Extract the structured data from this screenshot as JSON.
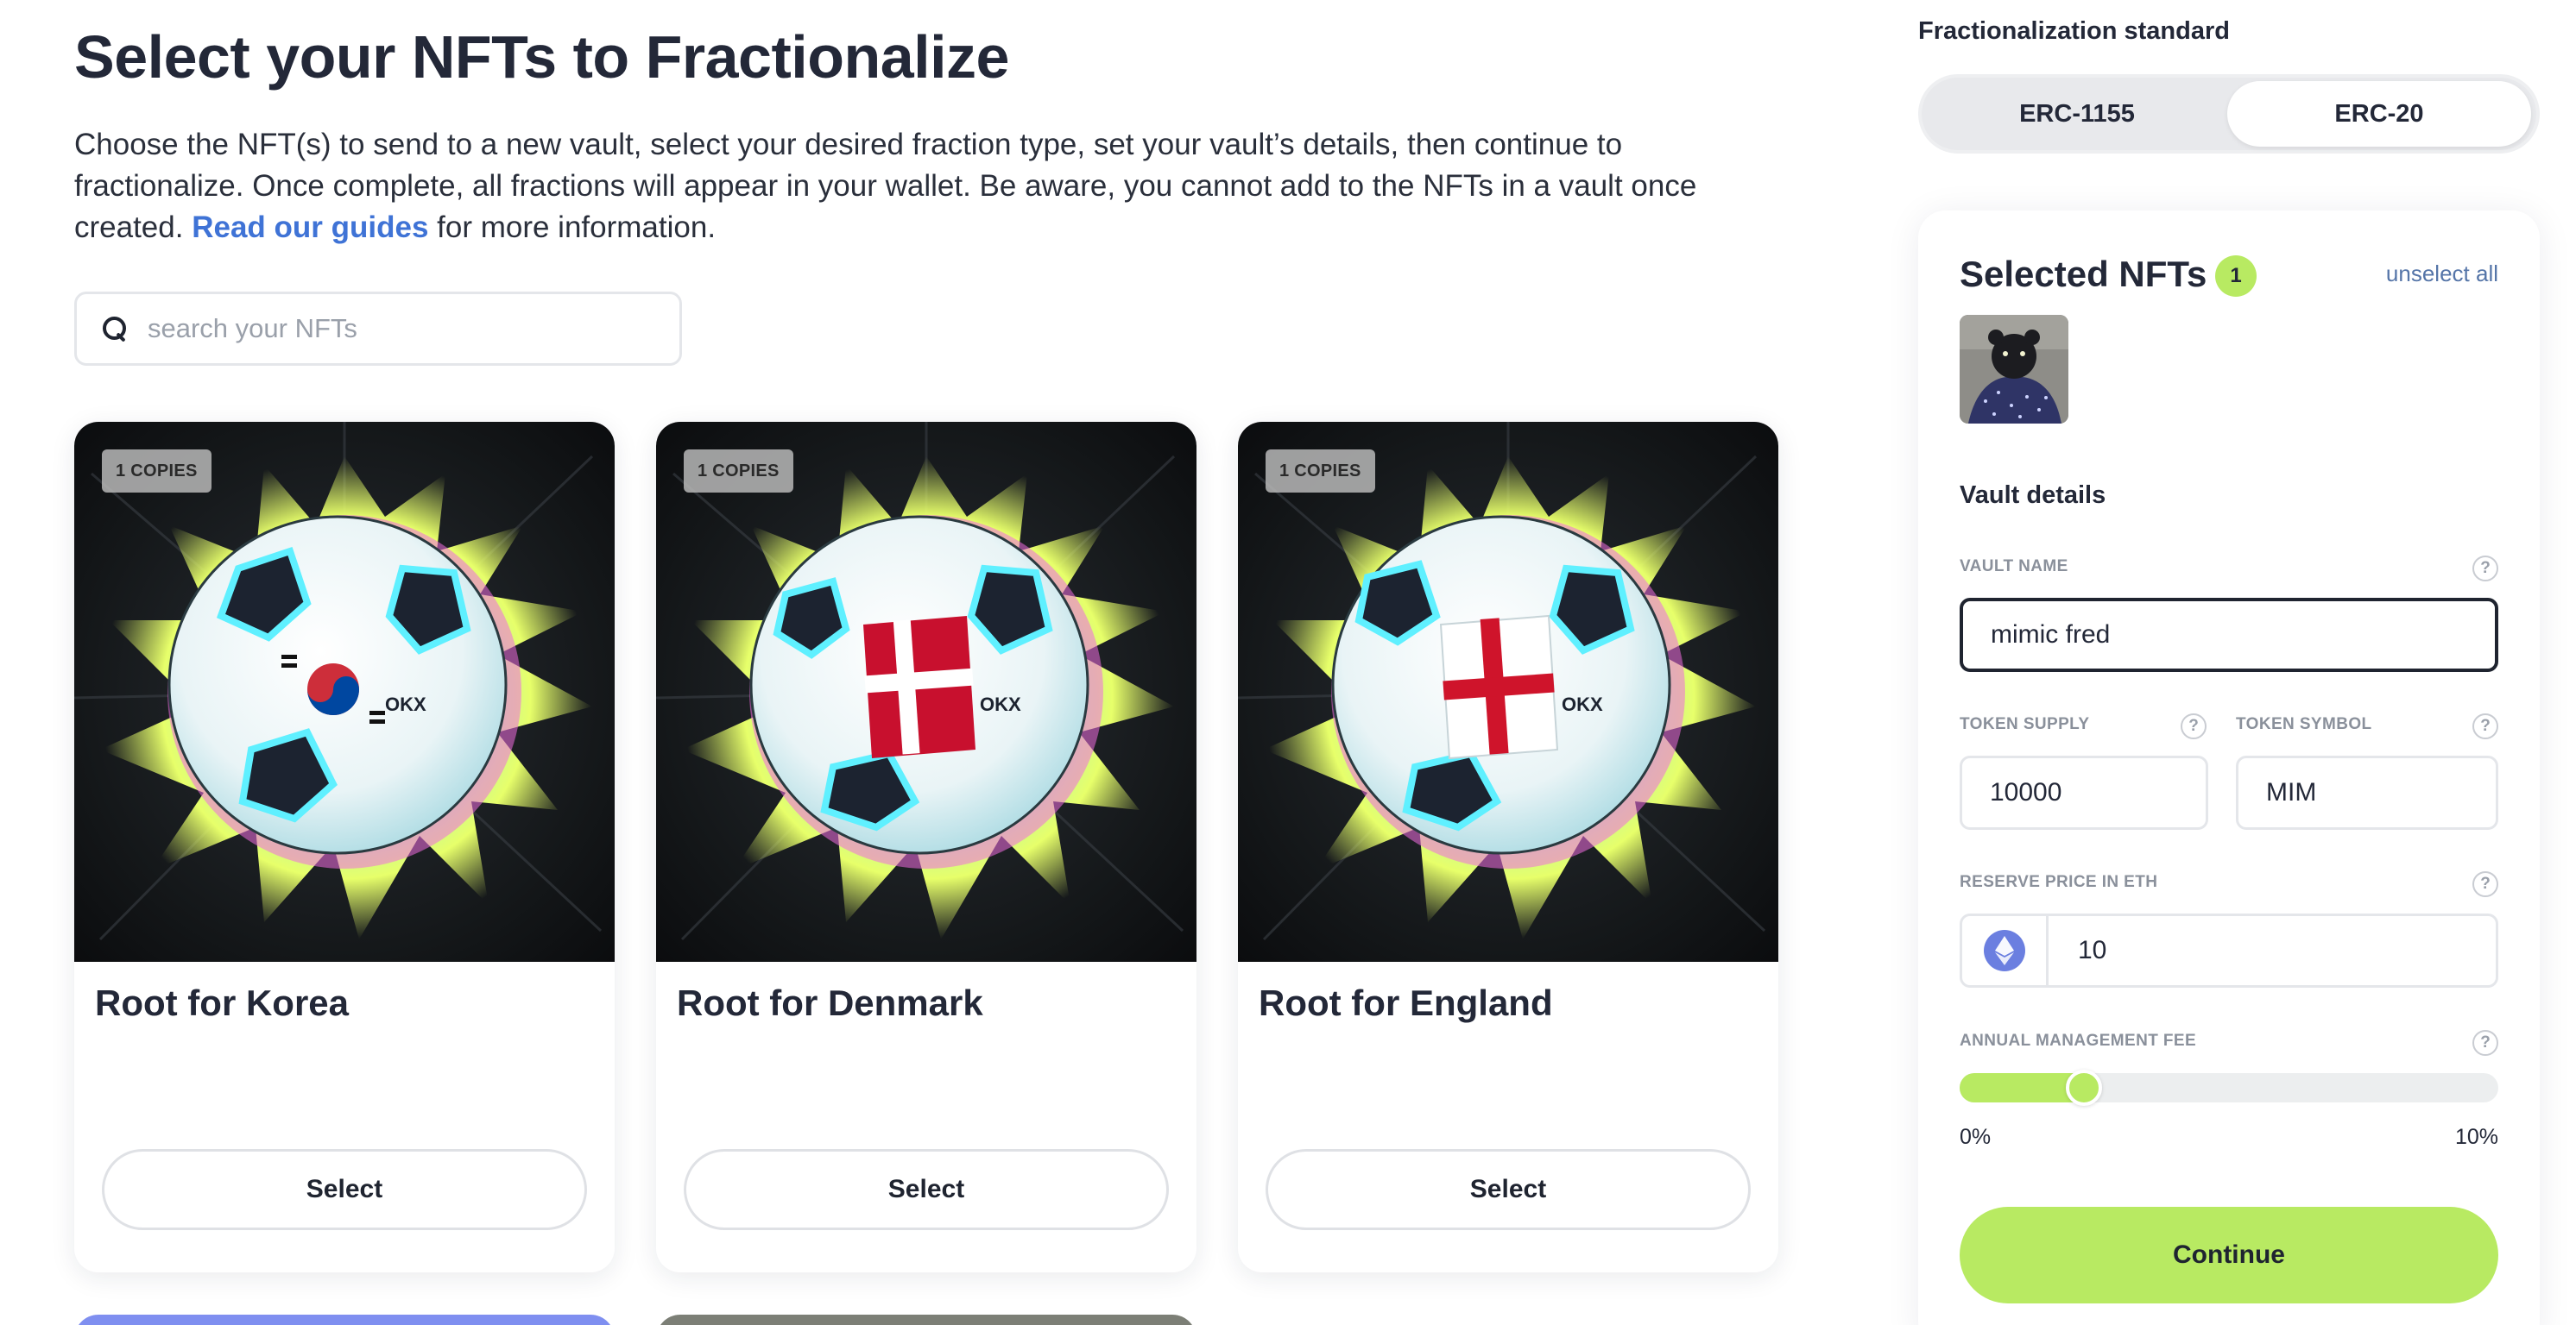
{
  "page": {
    "title": "Select your NFTs to Fractionalize",
    "intro_text": "Choose the NFT(s) to send to a new vault, select your desired fraction type, set your vault’s details, then continue to fractionalize. Once complete, all fractions will appear in your wallet. Be aware, you cannot add to the NFTs in a vault once created. ",
    "intro_link": "Read our guides",
    "intro_suffix": " for more information."
  },
  "search": {
    "placeholder": "search your NFTs",
    "icon": "search-icon"
  },
  "nfts": [
    {
      "copies": "1 COPIES",
      "name": "Root for Korea",
      "select_label": "Select",
      "flag": "korea"
    },
    {
      "copies": "1 COPIES",
      "name": "Root for Denmark",
      "select_label": "Select",
      "flag": "denmark"
    },
    {
      "copies": "1 COPIES",
      "name": "Root for England",
      "select_label": "Select",
      "flag": "england"
    }
  ],
  "standard": {
    "label": "Fractionalization standard",
    "options": [
      "ERC-1155",
      "ERC-20"
    ],
    "selected": "ERC-20"
  },
  "selected_panel": {
    "title": "Selected NFTs",
    "count": "1",
    "unselect_label": "unselect all"
  },
  "vault": {
    "title": "Vault details",
    "name_label": "VAULT NAME",
    "name_value": "mimic fred",
    "supply_label": "TOKEN SUPPLY",
    "supply_value": "10000",
    "symbol_label": "TOKEN SYMBOL",
    "symbol_value": "MIM",
    "reserve_label": "RESERVE PRICE IN ETH",
    "reserve_value": "10",
    "fee_label": "ANNUAL MANAGEMENT FEE",
    "fee_min": "0%",
    "fee_max": "10%",
    "fee_value_fraction": 0.23,
    "help_glyph": "?"
  },
  "continue_label": "Continue",
  "colors": {
    "accent": "#b8ea62",
    "link": "#3f73d6",
    "eth": "#6b7fe0"
  }
}
